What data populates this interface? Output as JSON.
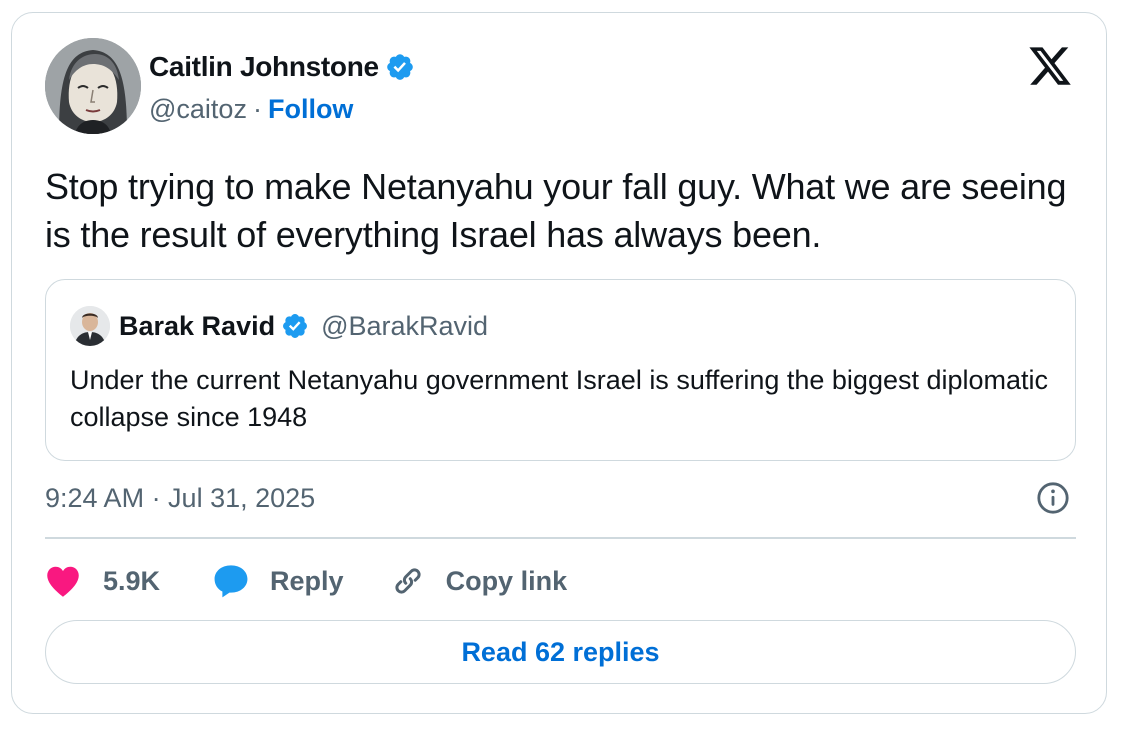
{
  "author": {
    "name": "Caitlin Johnstone",
    "handle": "@caitoz",
    "separator": "·",
    "follow_label": "Follow",
    "verified": true
  },
  "tweet": {
    "text": "Stop trying to make Netanyahu your fall guy. What we are seeing is the result of everything Israel has always been."
  },
  "quoted_tweet": {
    "name": "Barak Ravid",
    "handle": "@BarakRavid",
    "verified": true,
    "text": "Under the current Netanyahu government Israel is suffering the biggest diplomatic collapse since 1948"
  },
  "meta": {
    "timestamp": "9:24 AM · Jul 31, 2025"
  },
  "actions": {
    "like_count": "5.9K",
    "reply_label": "Reply",
    "copy_link_label": "Copy link",
    "read_replies_label": "Read 62 replies"
  },
  "colors": {
    "like": "#f91880",
    "reply": "#1d9bf0",
    "verified": "#1d9bf0",
    "link": "#006fd6",
    "secondary_text": "#536471",
    "border": "#cfd9de"
  },
  "icons": {
    "brand": "x-logo-icon",
    "verified": "verified-badge-icon",
    "info": "info-icon",
    "like": "heart-icon",
    "reply": "speech-bubble-icon",
    "copy_link": "link-icon"
  }
}
